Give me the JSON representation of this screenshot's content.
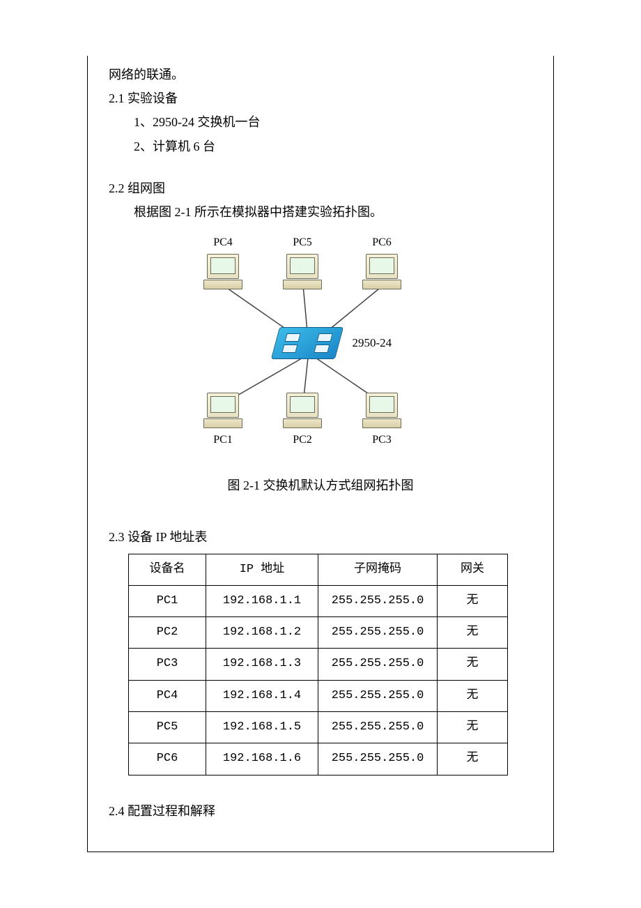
{
  "text": {
    "line1": "网络的联通。",
    "sec21": "2.1 实验设备",
    "eq1": "1、2950-24 交换机一台",
    "eq2": "2、计算机 6 台",
    "sec22": "2.2 组网图",
    "desc22": "根据图 2-1 所示在模拟器中搭建实验拓扑图。",
    "figcap": "图 2-1  交换机默认方式组网拓扑图",
    "sec23": "2.3 设备 IP 地址表",
    "sec24": "2.4 配置过程和解释"
  },
  "diagram": {
    "switch_label": "2950-24",
    "top": [
      "PC4",
      "PC5",
      "PC6"
    ],
    "bottom": [
      "PC1",
      "PC2",
      "PC3"
    ]
  },
  "table": {
    "headers": [
      "设备名",
      "IP 地址",
      "子网掩码",
      "网关"
    ],
    "rows": [
      [
        "PC1",
        "192.168.1.1",
        "255.255.255.0",
        "无"
      ],
      [
        "PC2",
        "192.168.1.2",
        "255.255.255.0",
        "无"
      ],
      [
        "PC3",
        "192.168.1.3",
        "255.255.255.0",
        "无"
      ],
      [
        "PC4",
        "192.168.1.4",
        "255.255.255.0",
        "无"
      ],
      [
        "PC5",
        "192.168.1.5",
        "255.255.255.0",
        "无"
      ],
      [
        "PC6",
        "192.168.1.6",
        "255.255.255.0",
        "无"
      ]
    ]
  }
}
